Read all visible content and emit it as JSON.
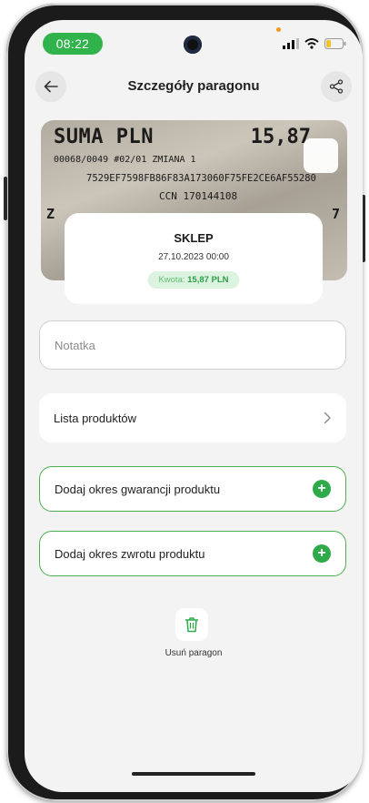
{
  "status_bar": {
    "time": "08:22",
    "accent_color": "#2fb34a",
    "icons": [
      "signal-icon",
      "wifi-icon",
      "battery-icon"
    ]
  },
  "header": {
    "title": "Szczegóły paragonu",
    "back_icon": "arrow-left-icon",
    "share_icon": "share-icon"
  },
  "receipt_image": {
    "line_total": "SUMA PLN",
    "line_total_value": "15,87",
    "line_2": "00068/0049 #02/01 ZMIANA 1",
    "line_3": "7529EF7598FB86F83A173060F75FE2CE6AF55280",
    "line_4": "CCN 170144108",
    "line_5_left": "Z",
    "line_5_right": "7"
  },
  "store": {
    "name": "SKLEP",
    "datetime": "27.10.2023 00:00",
    "amount_label": "Kwota:",
    "amount_value": "15,87 PLN"
  },
  "note_field": {
    "placeholder": "Notatka"
  },
  "products": {
    "label": "Lista produktów",
    "chevron_icon": "chevron-right-icon"
  },
  "warranty": {
    "label": "Dodaj okres gwarancji produktu",
    "icon": "plus-icon"
  },
  "returns": {
    "label": "Dodaj okres zwrotu produktu",
    "icon": "plus-icon"
  },
  "delete": {
    "label": "Usuń paragon",
    "icon": "trash-icon"
  },
  "colors": {
    "primary_green": "#2eaa4a",
    "border_green": "#4caf50",
    "badge_bg": "#dcf3df",
    "screen_bg": "#f3f3f3"
  }
}
